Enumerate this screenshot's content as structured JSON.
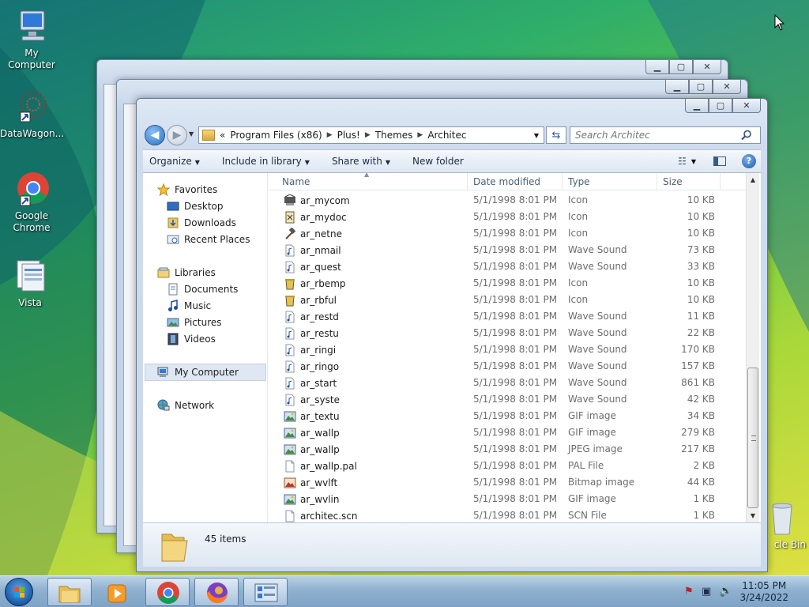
{
  "desktop": {
    "icons": [
      {
        "label": "My Computer",
        "icon": "my-computer-icon"
      },
      {
        "label": "DataWagon...",
        "icon": "datawagon-icon"
      },
      {
        "label": "Google Chrome",
        "icon": "chrome-icon"
      },
      {
        "label": "Vista",
        "icon": "vista-icon"
      },
      {
        "label": "cle Bin",
        "icon": "recycle-bin-icon"
      }
    ]
  },
  "window": {
    "address": {
      "chevron": "«",
      "crumbs": [
        "Program Files (x86)",
        "Plus!",
        "Themes",
        "Architec"
      ]
    },
    "search_placeholder": "Search Architec",
    "toolbar": {
      "organize": "Organize",
      "include_in_library": "Include in library",
      "share_with": "Share with",
      "new_folder": "New folder"
    },
    "nav": {
      "favorites": "Favorites",
      "desktop": "Desktop",
      "downloads": "Downloads",
      "recent_places": "Recent Places",
      "libraries": "Libraries",
      "documents": "Documents",
      "music": "Music",
      "pictures": "Pictures",
      "videos": "Videos",
      "my_computer": "My Computer",
      "network": "Network"
    },
    "columns": {
      "name": "Name",
      "date": "Date modified",
      "type": "Type",
      "size": "Size"
    },
    "files": [
      {
        "name": "ar_mycom",
        "date": "5/1/1998 8:01 PM",
        "type": "Icon",
        "size": "10 KB",
        "icon": "computer-icon"
      },
      {
        "name": "ar_mydoc",
        "date": "5/1/1998 8:01 PM",
        "type": "Icon",
        "size": "10 KB",
        "icon": "document-icon"
      },
      {
        "name": "ar_netne",
        "date": "5/1/1998 8:01 PM",
        "type": "Icon",
        "size": "10 KB",
        "icon": "hammer-icon"
      },
      {
        "name": "ar_nmail",
        "date": "5/1/1998 8:01 PM",
        "type": "Wave Sound",
        "size": "73 KB",
        "icon": "wave-sound-icon"
      },
      {
        "name": "ar_quest",
        "date": "5/1/1998 8:01 PM",
        "type": "Wave Sound",
        "size": "33 KB",
        "icon": "wave-sound-icon"
      },
      {
        "name": "ar_rbemp",
        "date": "5/1/1998 8:01 PM",
        "type": "Icon",
        "size": "10 KB",
        "icon": "bin-icon"
      },
      {
        "name": "ar_rbful",
        "date": "5/1/1998 8:01 PM",
        "type": "Icon",
        "size": "10 KB",
        "icon": "bin-icon"
      },
      {
        "name": "ar_restd",
        "date": "5/1/1998 8:01 PM",
        "type": "Wave Sound",
        "size": "11 KB",
        "icon": "wave-sound-icon"
      },
      {
        "name": "ar_restu",
        "date": "5/1/1998 8:01 PM",
        "type": "Wave Sound",
        "size": "22 KB",
        "icon": "wave-sound-icon"
      },
      {
        "name": "ar_ringi",
        "date": "5/1/1998 8:01 PM",
        "type": "Wave Sound",
        "size": "170 KB",
        "icon": "wave-sound-icon"
      },
      {
        "name": "ar_ringo",
        "date": "5/1/1998 8:01 PM",
        "type": "Wave Sound",
        "size": "157 KB",
        "icon": "wave-sound-icon"
      },
      {
        "name": "ar_start",
        "date": "5/1/1998 8:01 PM",
        "type": "Wave Sound",
        "size": "861 KB",
        "icon": "wave-sound-icon"
      },
      {
        "name": "ar_syste",
        "date": "5/1/1998 8:01 PM",
        "type": "Wave Sound",
        "size": "42 KB",
        "icon": "wave-sound-icon"
      },
      {
        "name": "ar_textu",
        "date": "5/1/1998 8:01 PM",
        "type": "GIF image",
        "size": "34 KB",
        "icon": "image-icon"
      },
      {
        "name": "ar_wallp",
        "date": "5/1/1998 8:01 PM",
        "type": "GIF image",
        "size": "279 KB",
        "icon": "image-icon"
      },
      {
        "name": "ar_wallp",
        "date": "5/1/1998 8:01 PM",
        "type": "JPEG image",
        "size": "217 KB",
        "icon": "image-icon"
      },
      {
        "name": "ar_wallp.pal",
        "date": "5/1/1998 8:01 PM",
        "type": "PAL File",
        "size": "2 KB",
        "icon": "blank-file-icon"
      },
      {
        "name": "ar_wvlft",
        "date": "5/1/1998 8:01 PM",
        "type": "Bitmap image",
        "size": "44 KB",
        "icon": "bitmap-icon"
      },
      {
        "name": "ar_wvlin",
        "date": "5/1/1998 8:01 PM",
        "type": "GIF image",
        "size": "1 KB",
        "icon": "image-icon"
      },
      {
        "name": "architec.scn",
        "date": "5/1/1998 8:01 PM",
        "type": "SCN File",
        "size": "1 KB",
        "icon": "blank-file-icon"
      }
    ],
    "status": {
      "item_count": "45 items"
    }
  },
  "taskbar": {
    "buttons": [
      "windows-explorer-icon",
      "media-player-icon",
      "chrome-icon",
      "firefox-icon",
      "control-panel-icon"
    ],
    "time": "11:05 PM",
    "date": "3/24/2022"
  }
}
